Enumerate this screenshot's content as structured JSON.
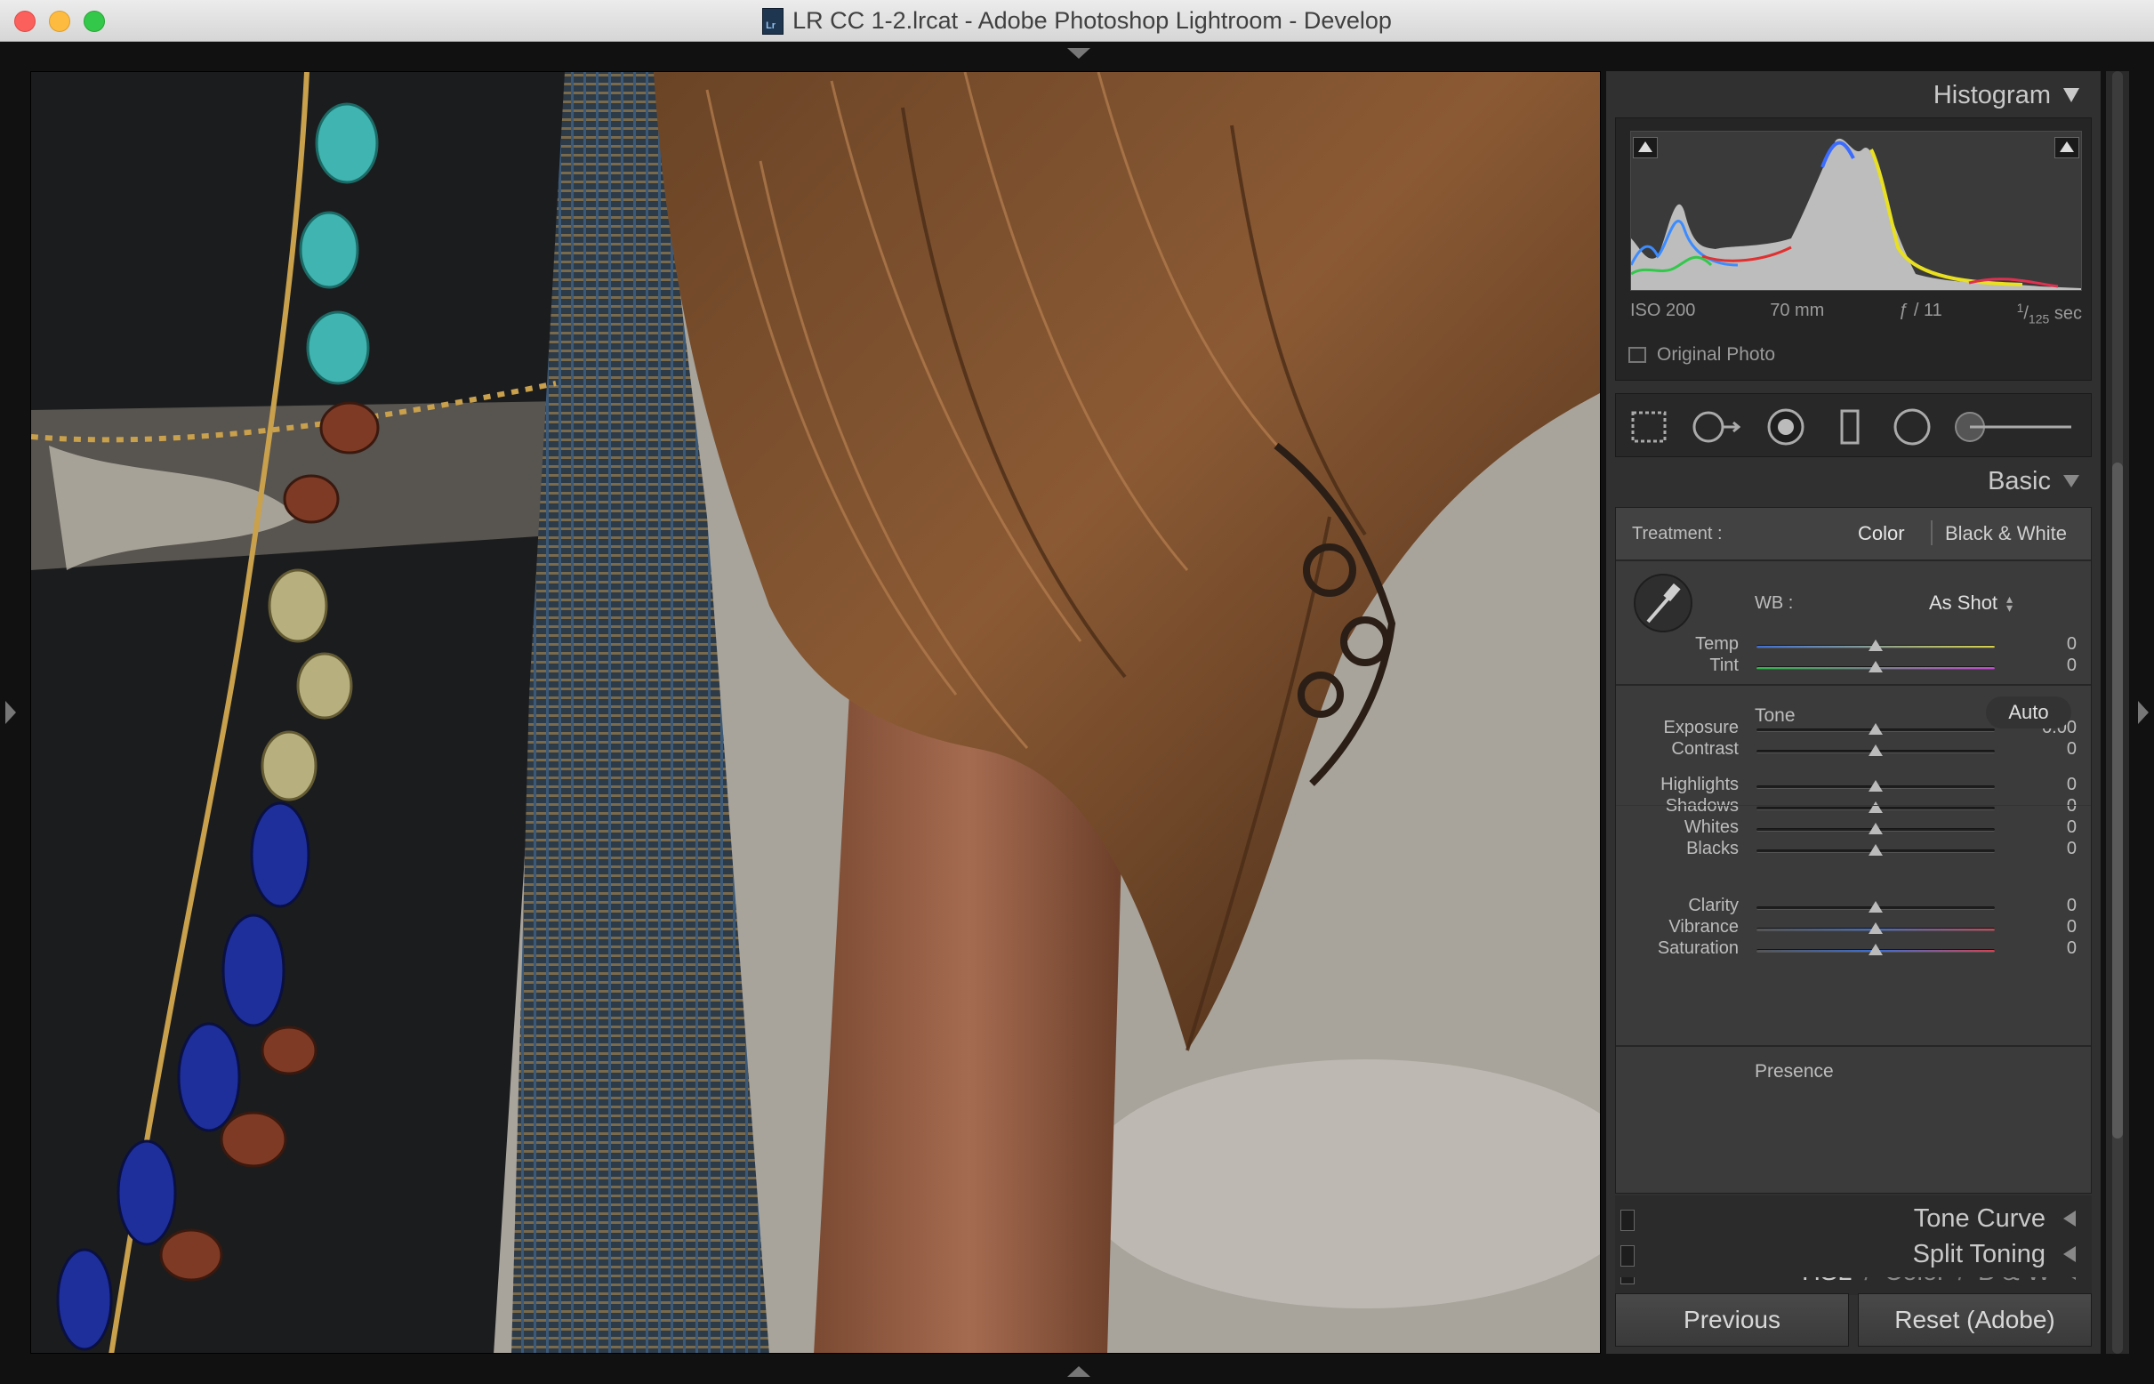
{
  "window": {
    "title": "LR CC 1-2.lrcat - Adobe Photoshop Lightroom - Develop",
    "doc_icon": "Lr"
  },
  "histogram": {
    "header": "Histogram",
    "exif": {
      "iso": "ISO 200",
      "focal": "70 mm",
      "aperture": "ƒ / 11",
      "shutter_num": "1",
      "shutter_den": "125",
      "shutter_unit": "sec"
    },
    "original_photo": "Original Photo"
  },
  "basic": {
    "header": "Basic",
    "treatment_label": "Treatment :",
    "treatment_color": "Color",
    "treatment_bw": "Black & White",
    "wb_label": "WB :",
    "wb_value": "As Shot",
    "tone_label": "Tone",
    "auto_label": "Auto",
    "presence_label": "Presence",
    "sliders": [
      {
        "label": "Temp",
        "value": "0"
      },
      {
        "label": "Tint",
        "value": "0"
      },
      {
        "label": "Exposure",
        "value": "0.00"
      },
      {
        "label": "Contrast",
        "value": "0"
      },
      {
        "label": "Highlights",
        "value": "0"
      },
      {
        "label": "Shadows",
        "value": "0"
      },
      {
        "label": "Whites",
        "value": "0"
      },
      {
        "label": "Blacks",
        "value": "0"
      },
      {
        "label": "Clarity",
        "value": "0"
      },
      {
        "label": "Vibrance",
        "value": "0"
      },
      {
        "label": "Saturation",
        "value": "0"
      }
    ]
  },
  "sections": {
    "tone_curve": "Tone Curve",
    "hsl": "HSL",
    "slash": "/",
    "color": "Color",
    "bw": "B & W",
    "split_toning": "Split Toning"
  },
  "buttons": {
    "previous": "Previous",
    "reset": "Reset (Adobe)"
  },
  "icons": [
    "close-icon",
    "minimize-icon",
    "zoom-icon",
    "crop-overlay-icon",
    "spot-removal-icon",
    "red-eye-icon",
    "graduated-filter-icon",
    "radial-filter-icon",
    "adjustment-brush-icon",
    "eyedropper-icon"
  ]
}
